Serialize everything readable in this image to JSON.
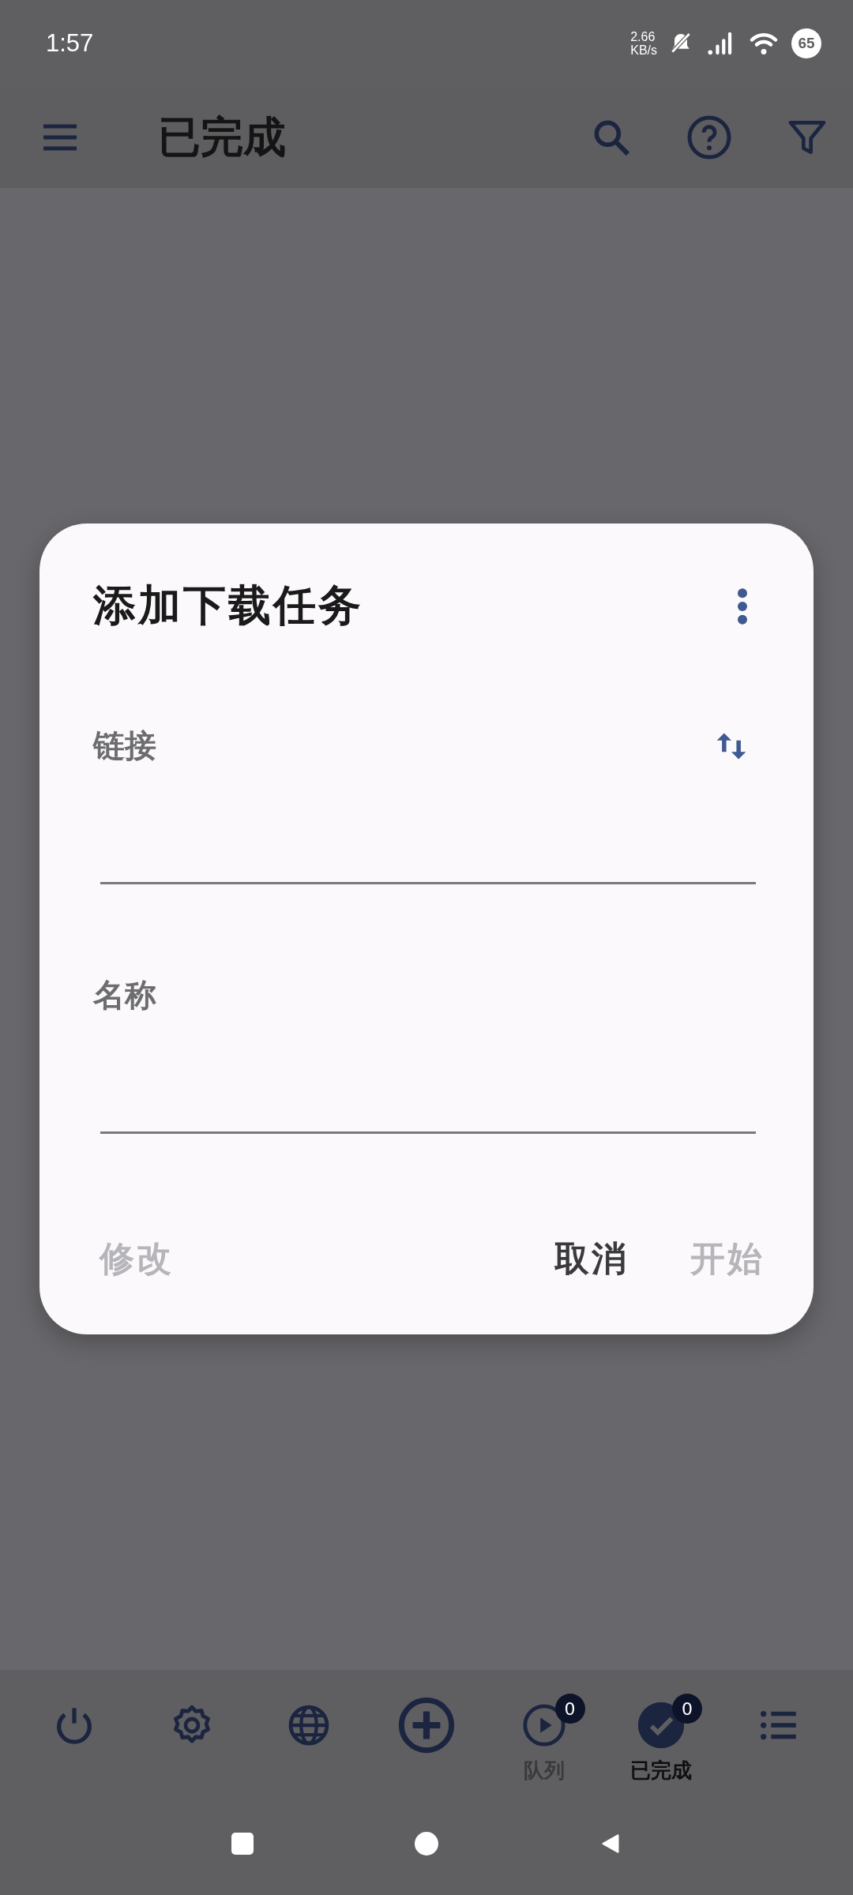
{
  "status_bar": {
    "time": "1:57",
    "net_speed_value": "2.66",
    "net_speed_unit": "KB/s",
    "battery": "65"
  },
  "app_bar": {
    "title": "已完成"
  },
  "dialog": {
    "title": "添加下载任务",
    "fields": [
      {
        "label": "链接",
        "kind": "link"
      },
      {
        "label": "名称",
        "kind": "plain"
      }
    ],
    "left_buttons": [
      {
        "label": "修改",
        "disabled": true
      }
    ],
    "right_buttons": [
      {
        "label": "取消",
        "disabled": false
      },
      {
        "label": "开始",
        "disabled": true
      }
    ]
  },
  "bottom_nav": [
    {
      "kind": "power",
      "selected": false
    },
    {
      "kind": "settings",
      "selected": false
    },
    {
      "kind": "globe",
      "selected": false
    },
    {
      "kind": "add",
      "selected": false
    },
    {
      "kind": "queue",
      "label": "队列",
      "badge": "0",
      "selected": false
    },
    {
      "kind": "done",
      "label": "已完成",
      "badge": "0",
      "selected": true
    },
    {
      "kind": "list",
      "selected": false
    }
  ]
}
